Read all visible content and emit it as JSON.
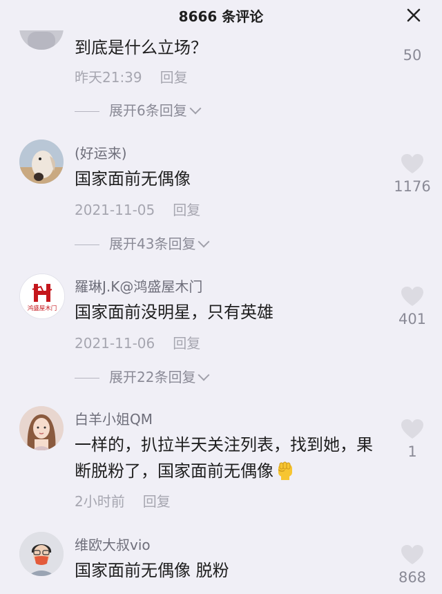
{
  "header": {
    "title": "8666 条评论"
  },
  "comments": [
    {
      "text": "到底是什么立场？",
      "time": "昨天21:39",
      "reply_label": "回复",
      "expand_label": "展开6条回复",
      "likes": "50",
      "avatar_icon": "gray-photo-avatar"
    },
    {
      "username": "(好运来)",
      "text": "国家面前无偶像",
      "time": "2021-11-05",
      "reply_label": "回复",
      "expand_label": "展开43条回复",
      "likes": "1176",
      "avatar_icon": "dog-photo-avatar"
    },
    {
      "username": "羅琳J.K@鸿盛屋木门",
      "text": "国家面前没明星，只有英雄",
      "time": "2021-11-06",
      "reply_label": "回复",
      "expand_label": "展开22条回复",
      "likes": "401",
      "avatar_icon": "company-logo-avatar",
      "avatar_logo_text": "鸿盛屋木门"
    },
    {
      "username": "白羊小姐QM",
      "text": "一样的，扒拉半天关注列表，找到她，果断脱粉了，国家面前无偶像",
      "emoji": "raised-fist-emoji",
      "time": "2小时前",
      "reply_label": "回复",
      "likes": "1",
      "avatar_icon": "woman-photo-avatar"
    },
    {
      "username": "维欧大叔vio",
      "text": "国家面前无偶像  脱粉",
      "likes": "868",
      "avatar_icon": "man-mask-photo-avatar"
    }
  ],
  "colors": {
    "background": "#f0eff6",
    "primary_text": "#1e1e1e",
    "secondary_text": "#a6a6b0",
    "heart_icon": "#dcdbe2"
  }
}
